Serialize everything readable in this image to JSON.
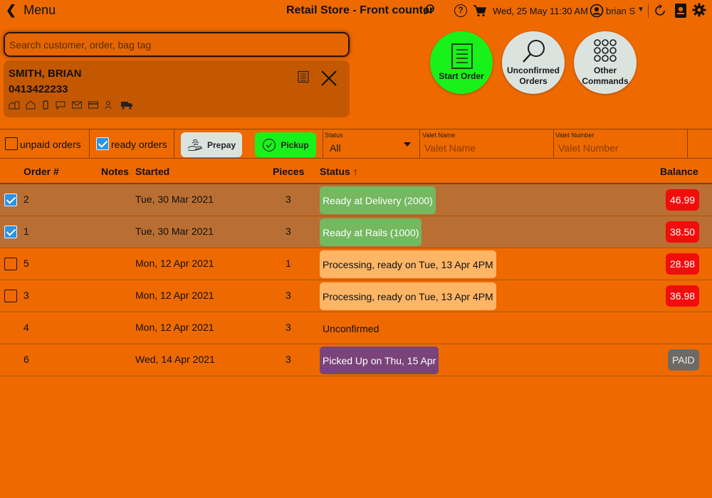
{
  "topbar": {
    "menu_label": "Menu",
    "store_title": "Retail Store - Front counter",
    "help_label": "?",
    "datetime": "Wed, 25 May 11:30 AM",
    "user_name": "brian S"
  },
  "search": {
    "placeholder": "Search customer, order, bag tag"
  },
  "customer": {
    "name": "SMITH, BRIAN",
    "phone": "0413422233"
  },
  "actions": {
    "start_order": "Start Order",
    "unconfirmed_1": "Unconfirmed",
    "unconfirmed_2": "Orders",
    "other_1": "Other",
    "other_2": "Commands"
  },
  "filters": {
    "unpaid_label": "unpaid orders",
    "ready_label": "ready orders",
    "prepay_label": "Prepay",
    "pickup_label": "Pickup",
    "status_caption": "Status",
    "status_value": "All",
    "valet_name_caption": "Valet Name",
    "valet_name_placeholder": "Valet Name",
    "valet_number_caption": "Valet Number",
    "valet_number_placeholder": "Valet Number"
  },
  "table": {
    "headers": {
      "order": "Order #",
      "notes": "Notes",
      "started": "Started",
      "pieces": "Pieces",
      "status": "Status",
      "status_sort": "↑",
      "balance": "Balance"
    },
    "rows": [
      {
        "order": "2",
        "started": "Tue, 30 Mar 2021",
        "pieces": "3",
        "status": "Ready at Delivery (2000)",
        "balance": "46.99"
      },
      {
        "order": "1",
        "started": "Tue, 30 Mar 2021",
        "pieces": "3",
        "status": "Ready at Rails (1000)",
        "balance": "38.50"
      },
      {
        "order": "5",
        "started": "Mon, 12 Apr 2021",
        "pieces": "1",
        "status": "Processing, ready on Tue, 13 Apr 4PM",
        "balance": "28.98"
      },
      {
        "order": "3",
        "started": "Mon, 12 Apr 2021",
        "pieces": "3",
        "status": "Processing, ready on Tue, 13 Apr 4PM",
        "balance": "36.98"
      },
      {
        "order": "4",
        "started": "Mon, 12 Apr 2021",
        "pieces": "3",
        "status": "Unconfirmed",
        "balance": ""
      },
      {
        "order": "6",
        "started": "Wed, 14 Apr 2021",
        "pieces": "3",
        "status": "Picked Up on Thu, 15 Apr",
        "balance": "PAID"
      }
    ]
  },
  "colors": {
    "background": "#ee6a00",
    "accent_green": "#18f21a",
    "balance_red": "#f20d0d",
    "ready_green": "#74b85f",
    "processing": "#ffb566",
    "picked_up": "#7a4379"
  }
}
